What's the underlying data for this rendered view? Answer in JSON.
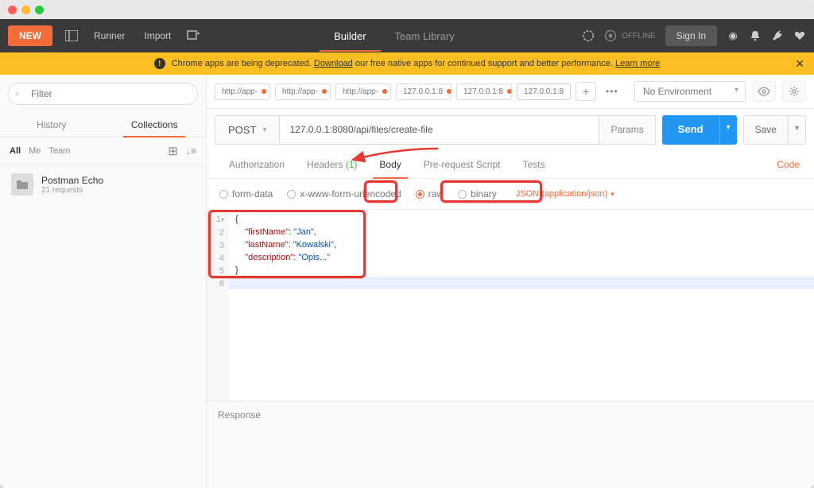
{
  "toolbar": {
    "new": "NEW",
    "runner": "Runner",
    "import": "Import",
    "builder": "Builder",
    "team_library": "Team Library",
    "offline": "OFFLINE",
    "signin": "Sign In"
  },
  "banner": {
    "text_before": "Chrome apps are being deprecated. ",
    "download": "Download",
    "text_mid": " our free native apps for continued support and better performance. ",
    "learn": "Learn more"
  },
  "sidebar": {
    "filter_placeholder": "Filter",
    "history": "History",
    "collections": "Collections",
    "all": "All",
    "me": "Me",
    "team": "Team",
    "collection_name": "Postman Echo",
    "collection_sub": "21 requests"
  },
  "tabs": [
    {
      "label": "http://app-",
      "dirty": true
    },
    {
      "label": "http://app-",
      "dirty": true
    },
    {
      "label": "http://app-",
      "dirty": true
    },
    {
      "label": "127.0.0.1:8",
      "dirty": true
    },
    {
      "label": "127.0.0.1:8",
      "dirty": true
    },
    {
      "label": "127.0.0.1:8",
      "dirty": false,
      "active": true
    }
  ],
  "env": {
    "selected": "No Environment"
  },
  "request": {
    "method": "POST",
    "url": "127.0.0.1:8080/api/files/create-file",
    "params": "Params",
    "send": "Send",
    "save": "Save"
  },
  "subtabs": {
    "authorization": "Authorization",
    "headers": "Headers",
    "headers_count": "(1)",
    "body": "Body",
    "prerequest": "Pre-request Script",
    "tests": "Tests",
    "code": "Code"
  },
  "body_types": {
    "form_data": "form-data",
    "urlencoded": "x-www-form-urlencoded",
    "raw": "raw",
    "binary": "binary",
    "content_type": "JSON (application/json)"
  },
  "editor": {
    "lines": [
      "1",
      "2",
      "3",
      "4",
      "5",
      "6"
    ],
    "json": {
      "firstName": "Jan",
      "lastName": "Kowalski",
      "description": "Opis..."
    }
  },
  "response_label": "Response"
}
